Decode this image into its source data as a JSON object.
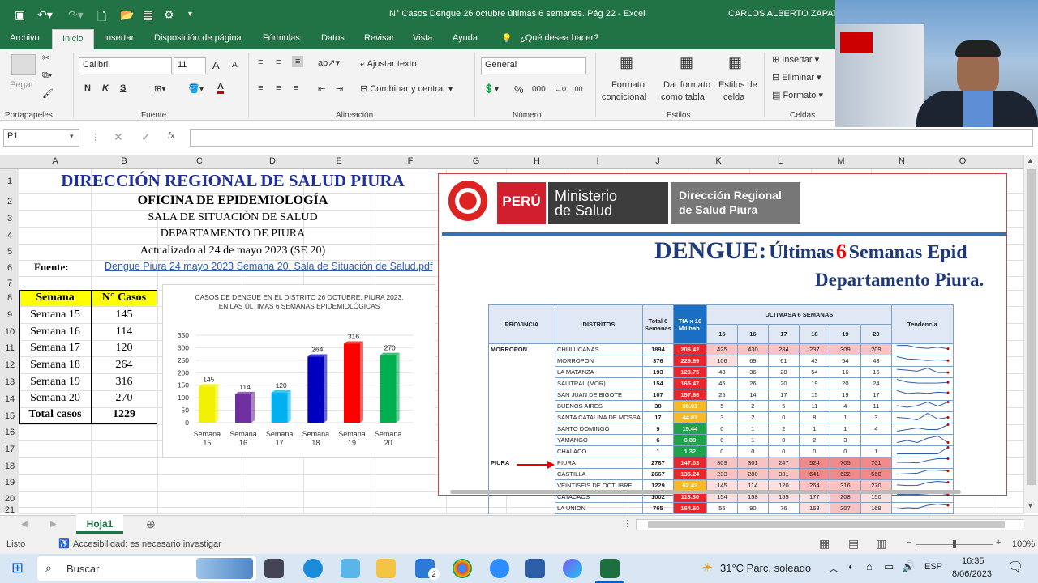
{
  "window": {
    "title": "N° Casos Dengue 26 octubre últimas 6 semanas. Pág 22  -  Excel",
    "user": "CARLOS ALBERTO ZAPATA"
  },
  "menu": [
    "Archivo",
    "Inicio",
    "Insertar",
    "Disposición de página",
    "Fórmulas",
    "Datos",
    "Revisar",
    "Vista",
    "Ayuda",
    "¿Qué desea hacer?"
  ],
  "ribbon": {
    "clipboard": {
      "paste": "Pegar",
      "group": "Portapapeles"
    },
    "font": {
      "name": "Calibri",
      "size": "11",
      "bold": "N",
      "italic": "K",
      "underline": "S",
      "grow": "A",
      "shrink": "A",
      "group": "Fuente"
    },
    "align": {
      "wrap": "Ajustar texto",
      "merge": "Combinar y centrar",
      "group": "Alineación"
    },
    "number": {
      "format": "General",
      "percent": "%",
      "thousands": "000",
      "group": "Número"
    },
    "styles": {
      "cond": "Formato",
      "cond2": "condicional",
      "table": "Dar formato",
      "table2": "como tabla",
      "cell": "Estilos de",
      "cell2": "celda",
      "group": "Estilos"
    },
    "cells": {
      "insert": "Insertar",
      "delete": "Eliminar",
      "format": "Formato",
      "group": "Celdas"
    }
  },
  "formula": {
    "namebox": "P1",
    "fx": "fx"
  },
  "columns": [
    "A",
    "B",
    "C",
    "D",
    "E",
    "F",
    "G",
    "H",
    "I",
    "J",
    "K",
    "L",
    "M",
    "N",
    "O"
  ],
  "rows": [
    "1",
    "2",
    "3",
    "4",
    "5",
    "6",
    "7",
    "8",
    "9",
    "10",
    "11",
    "12",
    "13",
    "14",
    "15",
    "16",
    "17",
    "18",
    "19",
    "20",
    "21"
  ],
  "sheet": {
    "title": "DIRECCIÓN REGIONAL DE SALUD PIURA",
    "office": "OFICINA DE EPIDEMIOLOGÍA",
    "room": "SALA DE SITUACIÓN DE SALUD",
    "dept": "DEPARTAMENTO DE PIURA",
    "updated": "Actualizado al 24 de mayo 2023 (SE 20)",
    "source_label": "Fuente:",
    "source_link": "Dengue Piura 24 mayo 2023 Semana 20. Sala de Situación de Salud.pdf",
    "headers": [
      "Semana",
      "N° Casos"
    ],
    "data": [
      [
        "Semana 15",
        "145"
      ],
      [
        "Semana 16",
        "114"
      ],
      [
        "Semana 17",
        "120"
      ],
      [
        "Semana 18",
        "264"
      ],
      [
        "Semana 19",
        "316"
      ],
      [
        "Semana 20",
        "270"
      ]
    ],
    "total": [
      "Total casos",
      "1229"
    ]
  },
  "chart_data": {
    "type": "bar",
    "title": "CASOS DE DENGUE EN EL DISTRITO 26 OCTUBRE, PIURA 2023, EN LAS ÚLTIMAS 6 SEMANAS EPIDEMIOLÓGICAS",
    "title_lines": [
      "CASOS DE DENGUE EN EL DISTRITO 26 OCTUBRE, PIURA 2023,",
      "EN LAS ÚLTIMAS 6 SEMANAS EPIDEMIOLÓGICAS"
    ],
    "categories": [
      "Semana 15",
      "Semana 16",
      "Semana 17",
      "Semana 18",
      "Semana 19",
      "Semana 20"
    ],
    "cat_line1": [
      "Semana",
      "Semana",
      "Semana",
      "Semana",
      "Semana",
      "Semana"
    ],
    "cat_line2": [
      "15",
      "16",
      "17",
      "18",
      "19",
      "20"
    ],
    "values": [
      145,
      114,
      120,
      264,
      316,
      270
    ],
    "colors": [
      "#f0f000",
      "#7030a0",
      "#00b0f0",
      "#0000c0",
      "#ff0000",
      "#00b050"
    ],
    "ylim": [
      0,
      350
    ],
    "yticks": [
      0,
      50,
      100,
      150,
      200,
      250,
      300,
      350
    ]
  },
  "minsa": {
    "peru": "PERÚ",
    "ministerio": "Ministerio",
    "de_salud": "de Salud",
    "direccion": "Dirección Regional",
    "de_salud_piura": "de Salud Piura",
    "headline_a": "DENGUE:",
    "headline_b": "Últimas",
    "headline_num": "6",
    "headline_c": "Semanas Epid",
    "subheadline": "Departamento Piura.",
    "col_prov": "PROVINCIA",
    "col_dist": "DISTRITOS",
    "col_total": "Total 6 Semanas",
    "col_tia": "TIA x 10 Mil hab.",
    "col_last": "ULTIMASA 6 SEMANAS",
    "col_trend": "Tendencia",
    "weeks": [
      "15",
      "16",
      "17",
      "18",
      "19",
      "20"
    ],
    "rows": [
      {
        "prov": "MORROPON",
        "dist": "CHULUCANAS",
        "total": "1894",
        "tia": "206.42",
        "w": [
          "425",
          "430",
          "284",
          "237",
          "309",
          "209"
        ]
      },
      {
        "prov": "",
        "dist": "MORROPON",
        "total": "376",
        "tia": "229.69",
        "w": [
          "106",
          "69",
          "61",
          "43",
          "54",
          "43"
        ]
      },
      {
        "prov": "",
        "dist": "LA MATANZA",
        "total": "193",
        "tia": "123.75",
        "w": [
          "43",
          "36",
          "28",
          "54",
          "16",
          "16"
        ]
      },
      {
        "prov": "",
        "dist": "SALITRAL (MOR)",
        "total": "154",
        "tia": "165.47",
        "w": [
          "45",
          "26",
          "20",
          "19",
          "20",
          "24"
        ]
      },
      {
        "prov": "",
        "dist": "SAN JUAN DE BIGOTE",
        "total": "107",
        "tia": "157.86",
        "w": [
          "25",
          "14",
          "17",
          "15",
          "19",
          "17"
        ]
      },
      {
        "prov": "",
        "dist": "BUENOS AIRES",
        "total": "38",
        "tia": "36.01",
        "w": [
          "5",
          "2",
          "5",
          "11",
          "4",
          "11"
        ]
      },
      {
        "prov": "",
        "dist": "SANTA CATALINA DE MOSSA",
        "total": "17",
        "tia": "44.82",
        "w": [
          "3",
          "2",
          "0",
          "8",
          "1",
          "3"
        ]
      },
      {
        "prov": "",
        "dist": "SANTO DOMINGO",
        "total": "9",
        "tia": "15.44",
        "w": [
          "0",
          "1",
          "2",
          "1",
          "1",
          "4"
        ]
      },
      {
        "prov": "",
        "dist": "YAMANGO",
        "total": "6",
        "tia": "6.88",
        "w": [
          "0",
          "1",
          "0",
          "2",
          "3",
          ""
        ]
      },
      {
        "prov": "",
        "dist": "CHALACO",
        "total": "1",
        "tia": "1.32",
        "w": [
          "0",
          "0",
          "0",
          "0",
          "0",
          "1"
        ]
      },
      {
        "prov": "PIURA",
        "dist": "PIURA",
        "total": "2787",
        "tia": "147.03",
        "w": [
          "309",
          "301",
          "247",
          "524",
          "705",
          "701"
        ]
      },
      {
        "prov": "",
        "dist": "CASTILLA",
        "total": "2667",
        "tia": "136.24",
        "w": [
          "233",
          "280",
          "331",
          "641",
          "622",
          "560"
        ]
      },
      {
        "prov": "",
        "dist": "VEINTISEIS DE OCTUBRE",
        "total": "1229",
        "tia": "62.42",
        "w": [
          "145",
          "114",
          "120",
          "264",
          "316",
          "270"
        ]
      },
      {
        "prov": "",
        "dist": "CATACAOS",
        "total": "1002",
        "tia": "118.30",
        "w": [
          "154",
          "158",
          "155",
          "177",
          "208",
          "150"
        ]
      },
      {
        "prov": "",
        "dist": "LA UNION",
        "total": "765",
        "tia": "164.60",
        "w": [
          "55",
          "90",
          "76",
          "168",
          "207",
          "169"
        ]
      }
    ]
  },
  "tabs": {
    "sheet": "Hoja1"
  },
  "status": {
    "ready": "Listo",
    "accessibility": "Accesibilidad: es necesario investigar",
    "zoom": "100%"
  },
  "taskbar": {
    "search": "Buscar",
    "weather": "31°C  Parc. soleado",
    "lang": "ESP",
    "time": "16:35",
    "date": "8/06/2023",
    "mail_badge": "2"
  }
}
